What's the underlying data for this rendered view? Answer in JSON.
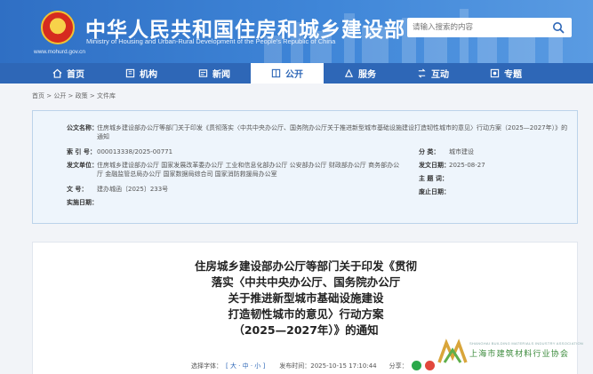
{
  "header": {
    "title": "中华人民共和国住房和城乡建设部",
    "subtitle": "Ministry of Housing and Urban-Rural Development of the People's Republic of China",
    "url": "www.mohurd.gov.cn",
    "search_placeholder": "请输入搜索的内容",
    "brand_color": "#2e67b7"
  },
  "nav": {
    "items": [
      {
        "label": "首页",
        "icon": "home-icon"
      },
      {
        "label": "机构",
        "icon": "org-icon"
      },
      {
        "label": "新闻",
        "icon": "news-icon"
      },
      {
        "label": "公开",
        "icon": "disclosure-icon",
        "active": true
      },
      {
        "label": "服务",
        "icon": "service-icon"
      },
      {
        "label": "互动",
        "icon": "interaction-icon"
      },
      {
        "label": "专题",
        "icon": "topic-icon"
      }
    ]
  },
  "breadcrumb": "首页 > 公开 > 政策 > 文件库",
  "info": {
    "pub_org_label": "公文名称：",
    "pub_org_value_line1": "住房城乡建设部办公厅等部门关于印发《贯彻落实〈中共中央办公厅、国务院办公厅关于推进新型城市基础设施建设打造韧性城市的意见〉行动方案（2025—2027年）》的",
    "pub_org_value_line2": "通知",
    "index_label": "索 引 号：",
    "index_value": "000013338/2025-00771",
    "issuer_label": "发文单位：",
    "issuer_value_line1": "住房城乡建设部办公厅   国家发展改革委办公厅   工业和信息化部办公厅   公安部办公厅   财政部办公厅   商务部办公",
    "issuer_value_line2": "厅   金融监管总局办公厅   国家数据局综合司   国家消防救援局办公室",
    "docno_label": "文    号：",
    "docno_value": "建办城函〔2025〕233号",
    "impl_label": "实施日期：",
    "impl_value": "",
    "category_label": "分    类：",
    "category_value": "城市建设",
    "date_label": "发文日期：",
    "date_value": "2025-08-27",
    "subject_label": "主 题 词：",
    "subject_value": "",
    "expire_label": "废止日期：",
    "expire_value": ""
  },
  "article": {
    "title_lines": [
      "住房城乡建设部办公厅等部门关于印发《贯彻",
      "落实〈中共中央办公厅、国务院办公厅",
      "关于推进新型城市基础设施建设",
      "打造韧性城市的意见〉行动方案",
      "（2025—2027年）》的通知"
    ],
    "font_size_label": "选择字体：",
    "font_size_options": "[ 大 · 中 · 小 ]",
    "publish_time": "发布时间：2025-10-15 17:10:44",
    "share_label": "分享："
  },
  "watermark": {
    "en": "SHANGHAI BUILDING MATERIALS INDUSTRY ASSOCIATION",
    "cn": "上海市建筑材料行业协会"
  }
}
